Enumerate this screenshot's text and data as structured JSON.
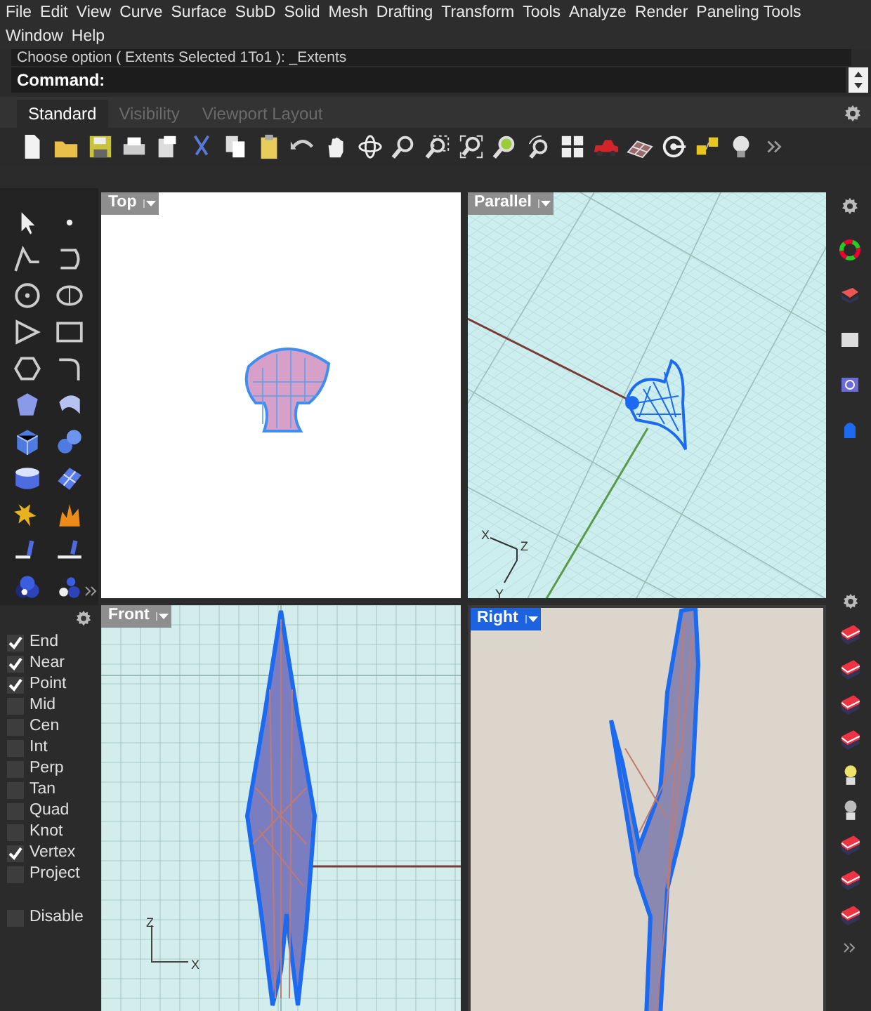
{
  "menu_rows": [
    [
      "File",
      "Edit",
      "View",
      "Curve",
      "Surface",
      "SubD",
      "Solid",
      "Mesh",
      "Drafting",
      "Transform",
      "Tools",
      "Analyze",
      "Render",
      "Paneling Tools"
    ],
    [
      "Window",
      "Help"
    ]
  ],
  "command": {
    "history": "Choose option ( Extents  Selected  1To1 ): _Extents",
    "prompt": "Command:"
  },
  "tabs": [
    {
      "label": "Standard",
      "selected": true
    },
    {
      "label": "Visibility",
      "selected": false
    },
    {
      "label": "Viewport Layout",
      "selected": false
    }
  ],
  "snaps": [
    {
      "label": "End",
      "checked": true
    },
    {
      "label": "Near",
      "checked": true
    },
    {
      "label": "Point",
      "checked": true
    },
    {
      "label": "Mid",
      "checked": false
    },
    {
      "label": "Cen",
      "checked": false
    },
    {
      "label": "Int",
      "checked": false
    },
    {
      "label": "Perp",
      "checked": false
    },
    {
      "label": "Tan",
      "checked": false
    },
    {
      "label": "Quad",
      "checked": false
    },
    {
      "label": "Knot",
      "checked": false
    },
    {
      "label": "Vertex",
      "checked": true
    },
    {
      "label": "Project",
      "checked": false
    }
  ],
  "disable_snap": {
    "label": "Disable",
    "checked": false
  },
  "viewports": [
    {
      "title": "Top",
      "kind": "top",
      "selected": false
    },
    {
      "title": "Parallel",
      "kind": "parallel",
      "selected": false,
      "axis_labels": [
        "X",
        "Z",
        "Y"
      ]
    },
    {
      "title": "Front",
      "kind": "front",
      "selected": false,
      "axis_labels": [
        "Z",
        "X"
      ]
    },
    {
      "title": "Right",
      "kind": "right",
      "selected": true
    }
  ]
}
